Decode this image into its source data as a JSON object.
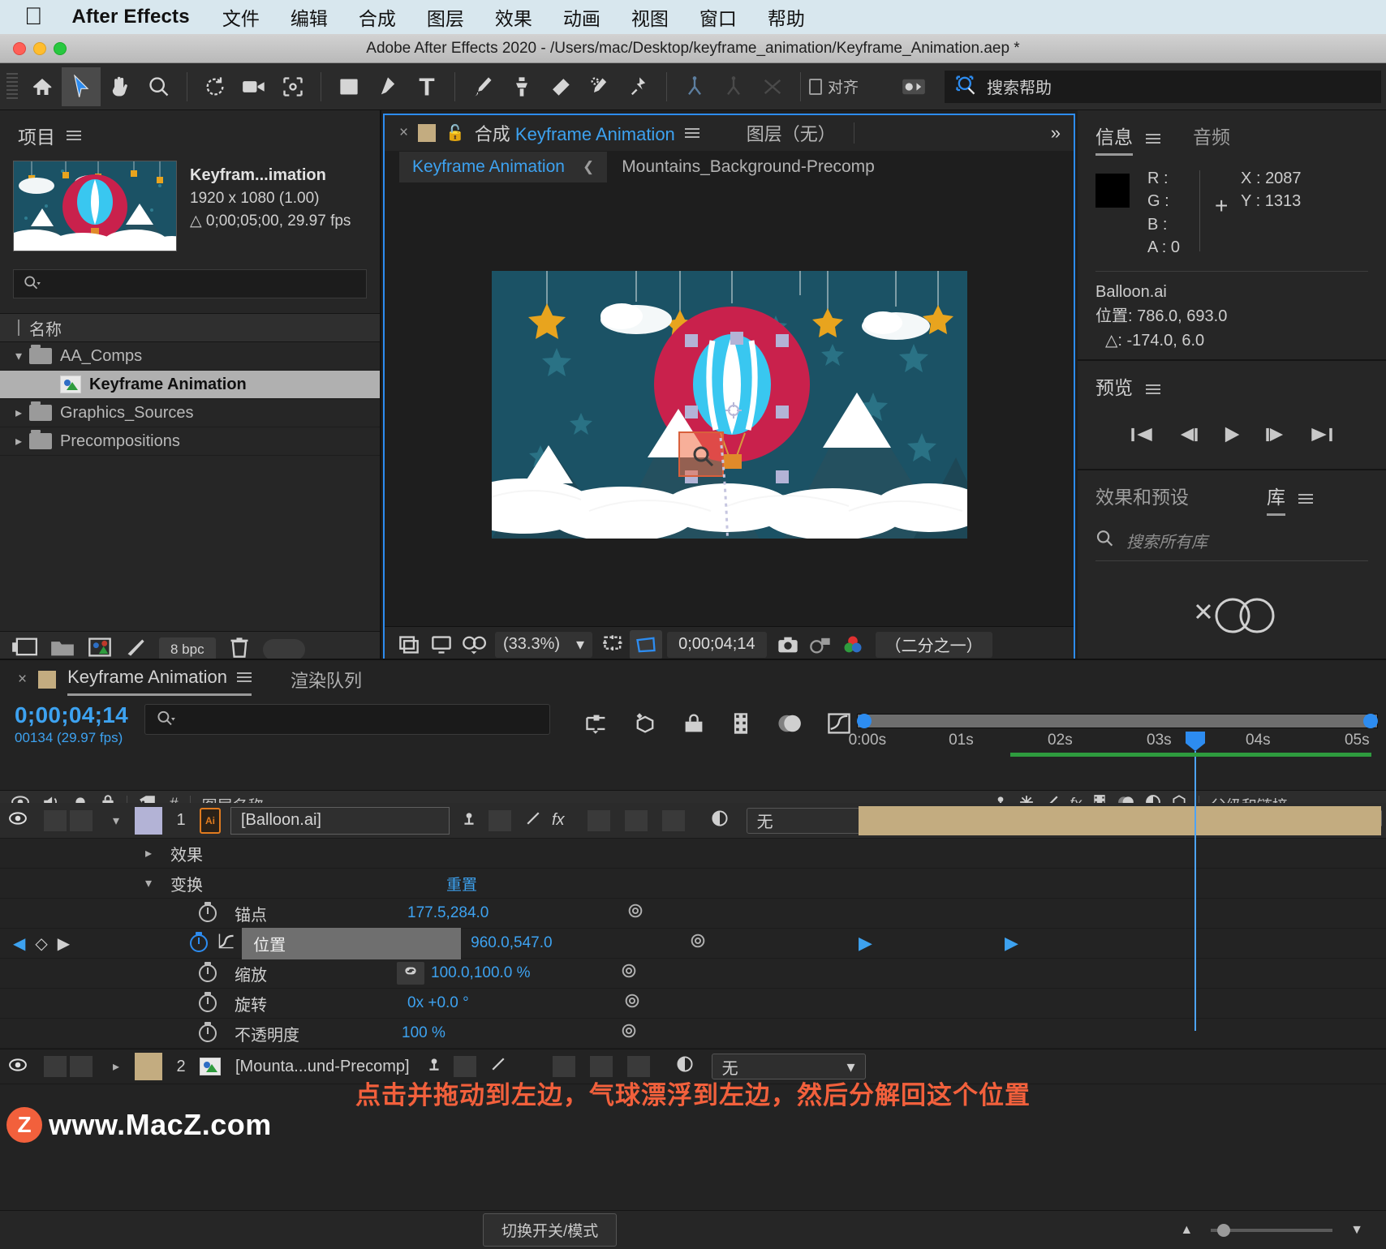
{
  "menubar": {
    "apple_icon": "apple-icon",
    "app_name": "After Effects",
    "items": [
      "文件",
      "编辑",
      "合成",
      "图层",
      "效果",
      "动画",
      "视图",
      "窗口",
      "帮助"
    ]
  },
  "titlebar": {
    "title": "Adobe After Effects 2020 - /Users/mac/Desktop/keyframe_animation/Keyframe_Animation.aep *"
  },
  "toolbar": {
    "tools": [
      "home-icon",
      "selection-arrow-icon",
      "hand-icon",
      "zoom-magnifier-icon",
      "rotate-icon",
      "camera-icon",
      "anchor-point-icon",
      "rectangle-icon",
      "pen-icon",
      "text-icon",
      "brush-icon",
      "clone-stamp-icon",
      "eraser-icon",
      "roto-brush-icon",
      "puppet-pin-icon"
    ],
    "rigging": [
      "unified-rig-icon",
      "puppet-starch-icon",
      "puppet-bend-icon"
    ],
    "snap_label": "对齐",
    "workspace_icon": "workspace-gear-icon",
    "search_icon": "search-help-icon",
    "search_placeholder": "搜索帮助"
  },
  "project": {
    "title": "项目",
    "menu_icon": "panel-menu-icon",
    "selected_item": {
      "name": "Keyfram...imation",
      "dimensions": "1920 x 1080 (1.00)",
      "duration": "△ 0;00;05;00, 29.97 fps"
    },
    "search_placeholder": "",
    "search_icon": "search-icon",
    "column_header": "名称",
    "items": [
      {
        "label": "AA_Comps",
        "type": "folder",
        "expanded": true,
        "depth": 0,
        "selected": false
      },
      {
        "label": "Keyframe Animation",
        "type": "comp",
        "expanded": false,
        "depth": 1,
        "selected": true
      },
      {
        "label": "Graphics_Sources",
        "type": "folder",
        "expanded": false,
        "depth": 0,
        "selected": false
      },
      {
        "label": "Precompositions",
        "type": "folder",
        "expanded": false,
        "depth": 0,
        "selected": false
      }
    ],
    "footer": {
      "icons": [
        "new-comp-icon",
        "new-folder-icon",
        "comp-settings-icon",
        "project-settings-icon",
        "delete-icon"
      ],
      "bit_depth": "8 bpc"
    }
  },
  "composition": {
    "close_icon": "close-tab-icon",
    "lock_icon": "lock-icon",
    "tab_prefix": "合成",
    "tab_name": "Keyframe Animation",
    "menu_icon": "panel-menu-icon",
    "layer_tab": "图层（无）",
    "expand_icon": "double-chevron-right-icon",
    "subtabs": [
      {
        "label": "Keyframe Animation",
        "active": true
      },
      {
        "label": "Mountains_Background-Precomp",
        "active": false
      }
    ],
    "bottom_toolbar": {
      "icons": [
        "toggle-view-icon",
        "display-icon",
        "3d-view-icon"
      ],
      "magnification": "(33.3%)",
      "resolution_icon": "region-of-interest-icon",
      "grid_icon": "transparency-grid-icon",
      "timecode": "0;00;04;14",
      "snapshot_icon": "snapshot-camera-icon",
      "show_snapshot_icon": "show-snapshot-icon",
      "channels_icon": "rgb-channels-icon",
      "resolution": "（二分之一）"
    }
  },
  "info_panel": {
    "tabs": [
      {
        "label": "信息",
        "active": true
      },
      {
        "label": "音频",
        "active": false
      }
    ],
    "menu_icon": "panel-menu-icon",
    "channels": [
      {
        "label": "R :",
        "value": ""
      },
      {
        "label": "G :",
        "value": ""
      },
      {
        "label": "B :",
        "value": ""
      },
      {
        "label": "A :",
        "value": "0"
      }
    ],
    "swatch_color": "#000000",
    "coords": [
      {
        "label": "X :",
        "value": "2087"
      },
      {
        "label": "Y :",
        "value": "1313"
      }
    ],
    "layer_name": "Balloon.ai",
    "position_line": "位置: 786.0, 693.0",
    "delta_line": "△: -174.0, 6.0"
  },
  "preview_panel": {
    "title": "预览",
    "menu_icon": "panel-menu-icon",
    "buttons": [
      "first-frame-icon",
      "previous-frame-icon",
      "play-icon",
      "next-frame-icon",
      "last-frame-icon"
    ]
  },
  "libraries_panel": {
    "tabs": [
      {
        "label": "效果和预设",
        "active": false
      },
      {
        "label": "库",
        "active": true
      }
    ],
    "menu_icon": "panel-menu-icon",
    "search_icon": "search-icon",
    "search_placeholder": "搜索所有库",
    "logo_icon": "creative-cloud-offline-icon",
    "footer_left_icon": "cloud-offline-icon",
    "footer_right_icon": "add-plus-icon"
  },
  "timeline": {
    "tabs": [
      {
        "label": "Keyframe Animation",
        "active": true
      },
      {
        "label": "渲染队列",
        "active": false
      }
    ],
    "close_icon": "close-tab-icon",
    "menu_icon": "panel-menu-icon",
    "timecode": "0;00;04;14",
    "frame_info": "00134 (29.97 fps)",
    "search_icon": "search-icon",
    "search_placeholder": "",
    "switch_icons": [
      "composition-mini-flowchart-icon",
      "draft-3d-icon",
      "hide-shy-layers-icon",
      "frame-blending-icon",
      "motion-blur-icon",
      "graph-editor-icon"
    ],
    "ruler_labels": [
      "0:00s",
      "01s",
      "02s",
      "03s",
      "04s",
      "05s"
    ],
    "column_headers": {
      "visibility_icons": [
        "eye-icon",
        "audio-icon",
        "solo-icon",
        "lock-icon"
      ],
      "label_icon": "label-color-icon",
      "number": "#",
      "layer_name": "图层名称",
      "switch_icons": [
        "anchor-switch-icon",
        "effects-switch-icon",
        "quality-switch-icon",
        "fx-switch-icon",
        "frame-blend-icon",
        "motion-blur-icon",
        "adjustment-layer-icon",
        "3d-layer-icon"
      ],
      "parent": "父级和链接"
    },
    "layers": [
      {
        "index": "1",
        "name": "[Balloon.ai]",
        "type_icon": "ai-file-icon",
        "parent": "无",
        "expanded": true,
        "bar_color": "#b3b3d6",
        "groups": [
          {
            "label": "效果",
            "expanded": false
          },
          {
            "label": "变换",
            "expanded": true,
            "reset_label": "重置",
            "properties": [
              {
                "label": "锚点",
                "value": "177.5,284.0",
                "animated": false,
                "selected": false,
                "has_graph": false,
                "linked": false
              },
              {
                "label": "位置",
                "value": "960.0,547.0",
                "animated": true,
                "selected": true,
                "has_graph": true,
                "linked": false
              },
              {
                "label": "缩放",
                "value": "100.0,100.0 %",
                "animated": false,
                "selected": false,
                "has_graph": false,
                "linked": true
              },
              {
                "label": "旋转",
                "value": "0x +0.0 °",
                "animated": false,
                "selected": false,
                "has_graph": false,
                "linked": false
              },
              {
                "label": "不透明度",
                "value": "100 %",
                "animated": false,
                "selected": false,
                "has_graph": false,
                "linked": false
              }
            ]
          }
        ]
      },
      {
        "index": "2",
        "name": "[Mounta...und-Precomp]",
        "type_icon": "comp-icon",
        "parent": "无",
        "expanded": false,
        "bar_color": "#c3ac80",
        "groups": []
      }
    ],
    "keyframes_seconds": [
      0.05,
      1.15
    ],
    "footer": {
      "toggle_label": "切换开关/模式"
    }
  },
  "annotation": {
    "text": "点击并拖动到左边，气球漂浮到左边，然后分解回这个位置",
    "color": "#f2603c"
  },
  "watermark": {
    "badge": "Z",
    "text": "www.MacZ.com"
  }
}
